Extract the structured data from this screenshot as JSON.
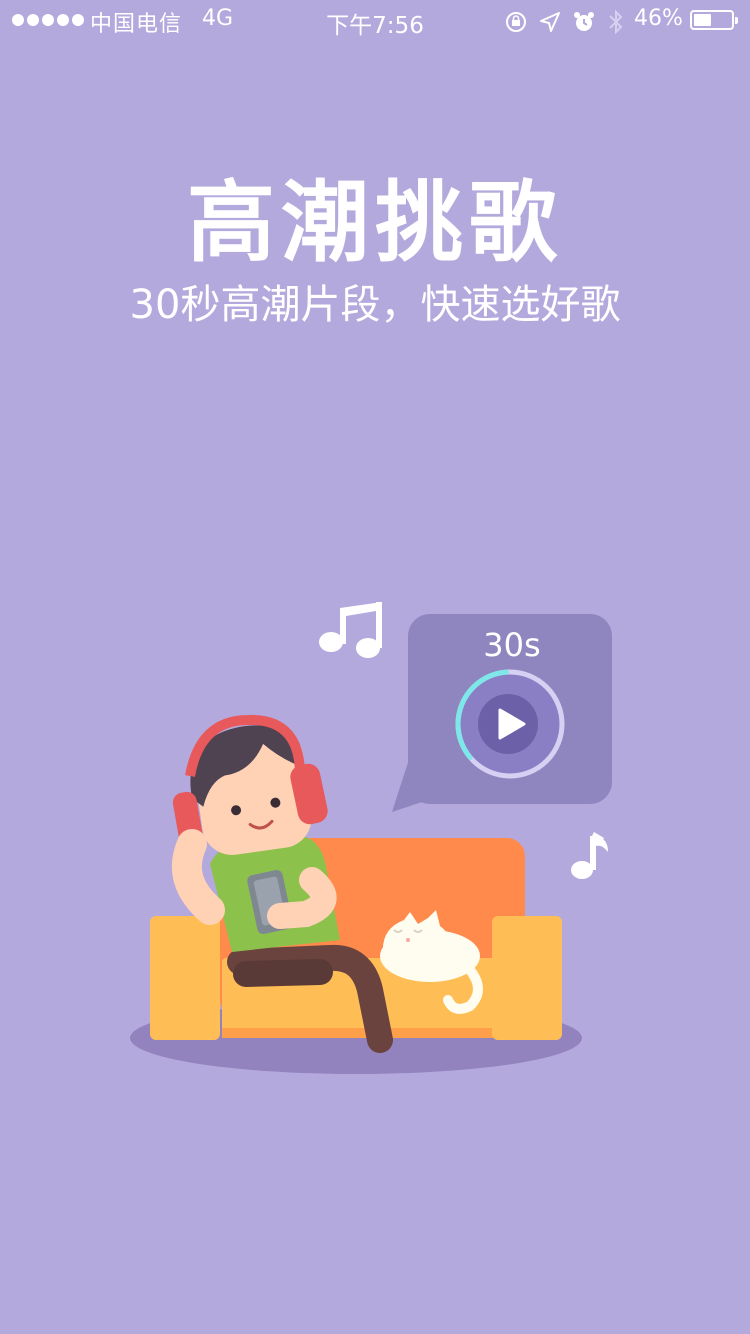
{
  "status_bar": {
    "carrier": "中国电信",
    "network": "4G",
    "time": "下午7:56",
    "battery_percent_label": "46%",
    "battery_level": 0.46
  },
  "heading": {
    "title": "高潮挑歌",
    "subtitle": "30秒高潮片段，快速选好歌"
  },
  "illustration": {
    "timer_label": "30s",
    "timer_progress": 0.35
  },
  "colors": {
    "background": "#B4A9DD",
    "bubble": "#8F86C0",
    "sofa_back": "#FF8A4C",
    "sofa_front": "#FFBE55",
    "accent_ring": "#7EE8E8"
  },
  "icons": {
    "status": [
      "orientation-lock-icon",
      "location-arrow-icon",
      "alarm-clock-icon",
      "bluetooth-icon",
      "battery-icon"
    ],
    "illustration": [
      "music-note-double-icon",
      "music-note-single-icon",
      "play-icon"
    ]
  }
}
